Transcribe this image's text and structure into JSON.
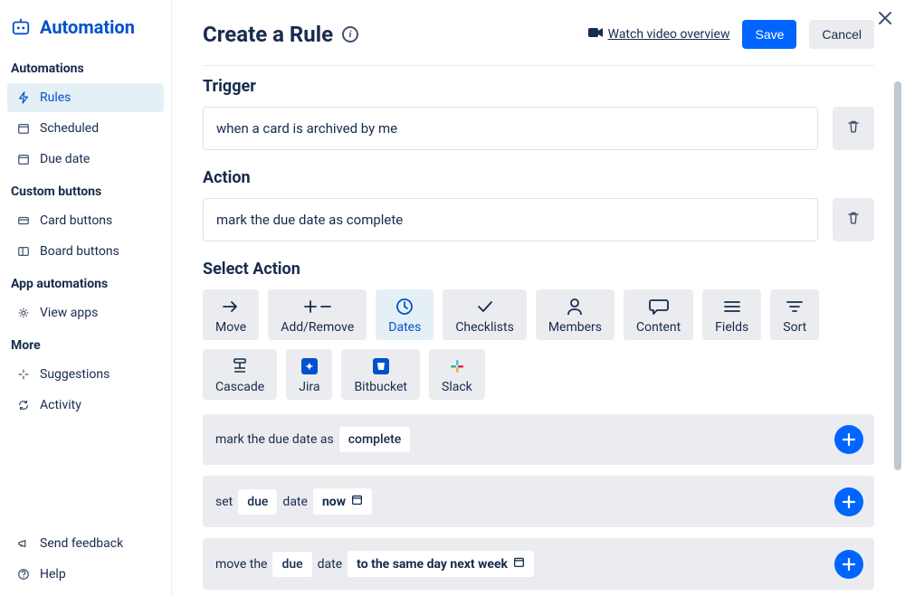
{
  "brand": {
    "title": "Automation"
  },
  "sidebar": {
    "sections": {
      "automations": {
        "header": "Automations",
        "items": [
          "Rules",
          "Scheduled",
          "Due date"
        ]
      },
      "custom_buttons": {
        "header": "Custom buttons",
        "items": [
          "Card buttons",
          "Board buttons"
        ]
      },
      "app_automations": {
        "header": "App automations",
        "items": [
          "View apps"
        ]
      },
      "more": {
        "header": "More",
        "items": [
          "Suggestions",
          "Activity"
        ]
      }
    },
    "footer": [
      "Send feedback",
      "Help"
    ]
  },
  "header": {
    "title": "Create a Rule",
    "video_link": "Watch video overview",
    "save": "Save",
    "cancel": "Cancel"
  },
  "trigger": {
    "title": "Trigger",
    "value": "when a card is archived by me"
  },
  "action": {
    "title": "Action",
    "value": "mark the due date as complete"
  },
  "select_action": {
    "title": "Select Action",
    "categories": [
      "Move",
      "Add/Remove",
      "Dates",
      "Checklists",
      "Members",
      "Content",
      "Fields",
      "Sort",
      "Cascade",
      "Jira",
      "Bitbucket",
      "Slack"
    ],
    "active": "Dates"
  },
  "templates": {
    "t1": {
      "prefix": "mark the due date as",
      "pill": "complete"
    },
    "t2": {
      "prefix": "set",
      "field": "due",
      "mid": "date",
      "value": "now"
    },
    "t3": {
      "prefix": "move the",
      "field": "due",
      "mid": "date",
      "value": "to the same day next week"
    }
  }
}
